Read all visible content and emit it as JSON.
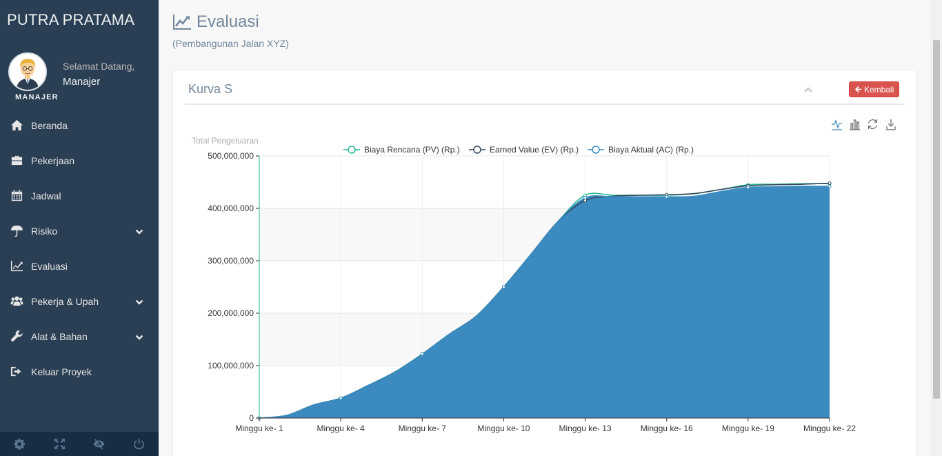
{
  "app": {
    "brand": "PUTRA PRATAMA"
  },
  "profile": {
    "welcome": "Selamat Datang,",
    "name": "Manajer",
    "role": "MANAJER"
  },
  "sidebar": {
    "items": [
      {
        "label": "Beranda",
        "icon": "home-icon",
        "expandable": false
      },
      {
        "label": "Pekerjaan",
        "icon": "briefcase-icon",
        "expandable": false
      },
      {
        "label": "Jadwal",
        "icon": "calendar-icon",
        "expandable": false
      },
      {
        "label": "Risiko",
        "icon": "umbrella-icon",
        "expandable": true
      },
      {
        "label": "Evaluasi",
        "icon": "line-chart-icon",
        "expandable": false
      },
      {
        "label": "Pekerja & Upah",
        "icon": "users-icon",
        "expandable": true
      },
      {
        "label": "Alat & Bahan",
        "icon": "wrench-icon",
        "expandable": true
      },
      {
        "label": "Keluar Proyek",
        "icon": "sign-out-icon",
        "expandable": false
      }
    ],
    "footer": [
      "gear-icon",
      "fullscreen-icon",
      "eye-slash-icon",
      "power-icon"
    ]
  },
  "page": {
    "title": "Evaluasi",
    "subtitle": "(Pembangunan Jalan XYZ)"
  },
  "panel": {
    "title": "Kurva S",
    "back_label": "Kembali"
  },
  "colors": {
    "sidebar": "#2a3f54",
    "pv": "#26b99a",
    "ev": "#34495e",
    "ac": "#3a8cbf",
    "ac_fill": "#3b8bc0",
    "danger": "#d9534f"
  },
  "chart_data": {
    "type": "area",
    "ylabel": "Total Pengeluaran",
    "ylim": [
      0,
      500000000
    ],
    "yticks": [
      "0",
      "100,000,000",
      "200,000,000",
      "300,000,000",
      "400,000,000",
      "500,000,000"
    ],
    "tick_labels": [
      "Minggu ke- 1",
      "Minggu ke- 4",
      "Minggu ke- 7",
      "Minggu ke- 10",
      "Minggu ke- 13",
      "Minggu ke- 16",
      "Minggu ke- 19",
      "Minggu ke- 22"
    ],
    "weeks": [
      1,
      2,
      3,
      4,
      5,
      6,
      7,
      8,
      9,
      10,
      11,
      12,
      13,
      14,
      15,
      16,
      17,
      18,
      19,
      20,
      21,
      22
    ],
    "series": [
      {
        "name": "Biaya Rencana (PV) (Rp.)",
        "values": [
          0,
          5000000,
          25000000,
          38000000,
          62000000,
          88000000,
          122000000,
          160000000,
          195000000,
          250000000,
          312000000,
          375000000,
          425000000,
          425000000,
          425000000,
          425000000,
          428000000,
          436000000,
          445000000,
          446000000,
          447000000,
          447000000
        ]
      },
      {
        "name": "Earned Value (EV) (Rp.)",
        "values": [
          0,
          5000000,
          25000000,
          38000000,
          62000000,
          88000000,
          122000000,
          160000000,
          195000000,
          250000000,
          312000000,
          375000000,
          415000000,
          423000000,
          425000000,
          426000000,
          428000000,
          436000000,
          443000000,
          445000000,
          446000000,
          448000000
        ]
      },
      {
        "name": "Biaya Aktual (AC) (Rp.)",
        "values": [
          0,
          5000000,
          25000000,
          38000000,
          62000000,
          88000000,
          122000000,
          160000000,
          195000000,
          250000000,
          312000000,
          375000000,
          420000000,
          422000000,
          422000000,
          422000000,
          423000000,
          432000000,
          440000000,
          441000000,
          442000000,
          442000000
        ]
      }
    ],
    "grid": true,
    "legend": "top-center",
    "toolbox": [
      "line-chart-icon",
      "bar-chart-icon",
      "refresh-icon",
      "download-icon"
    ]
  }
}
